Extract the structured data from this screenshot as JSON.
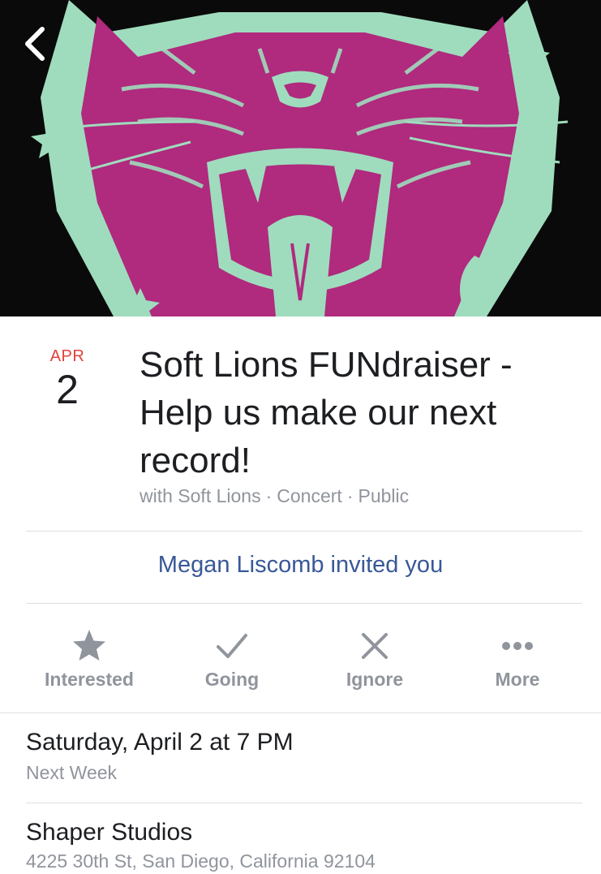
{
  "event": {
    "date_month": "APR",
    "date_day": "2",
    "title": "Soft Lions FUNdraiser - Help us make our next record!",
    "meta": {
      "host": "with Soft Lions",
      "category": "Concert",
      "privacy": "Public"
    },
    "invite_text": "Megan Liscomb invited you"
  },
  "actions": [
    {
      "label": "Interested",
      "icon": "star-icon"
    },
    {
      "label": "Going",
      "icon": "check-icon"
    },
    {
      "label": "Ignore",
      "icon": "close-icon"
    },
    {
      "label": "More",
      "icon": "more-dots-icon"
    }
  ],
  "details": {
    "datetime": "Saturday, April 2 at 7 PM",
    "relative": "Next Week",
    "venue": "Shaper Studios",
    "address": "4225 30th St, San Diego, California 92104"
  },
  "colors": {
    "accent_link": "#385898",
    "date_month": "#e0423a",
    "cover_magenta": "#b02a7e",
    "cover_mint": "#9fdcbd",
    "muted_text": "#90949c"
  }
}
